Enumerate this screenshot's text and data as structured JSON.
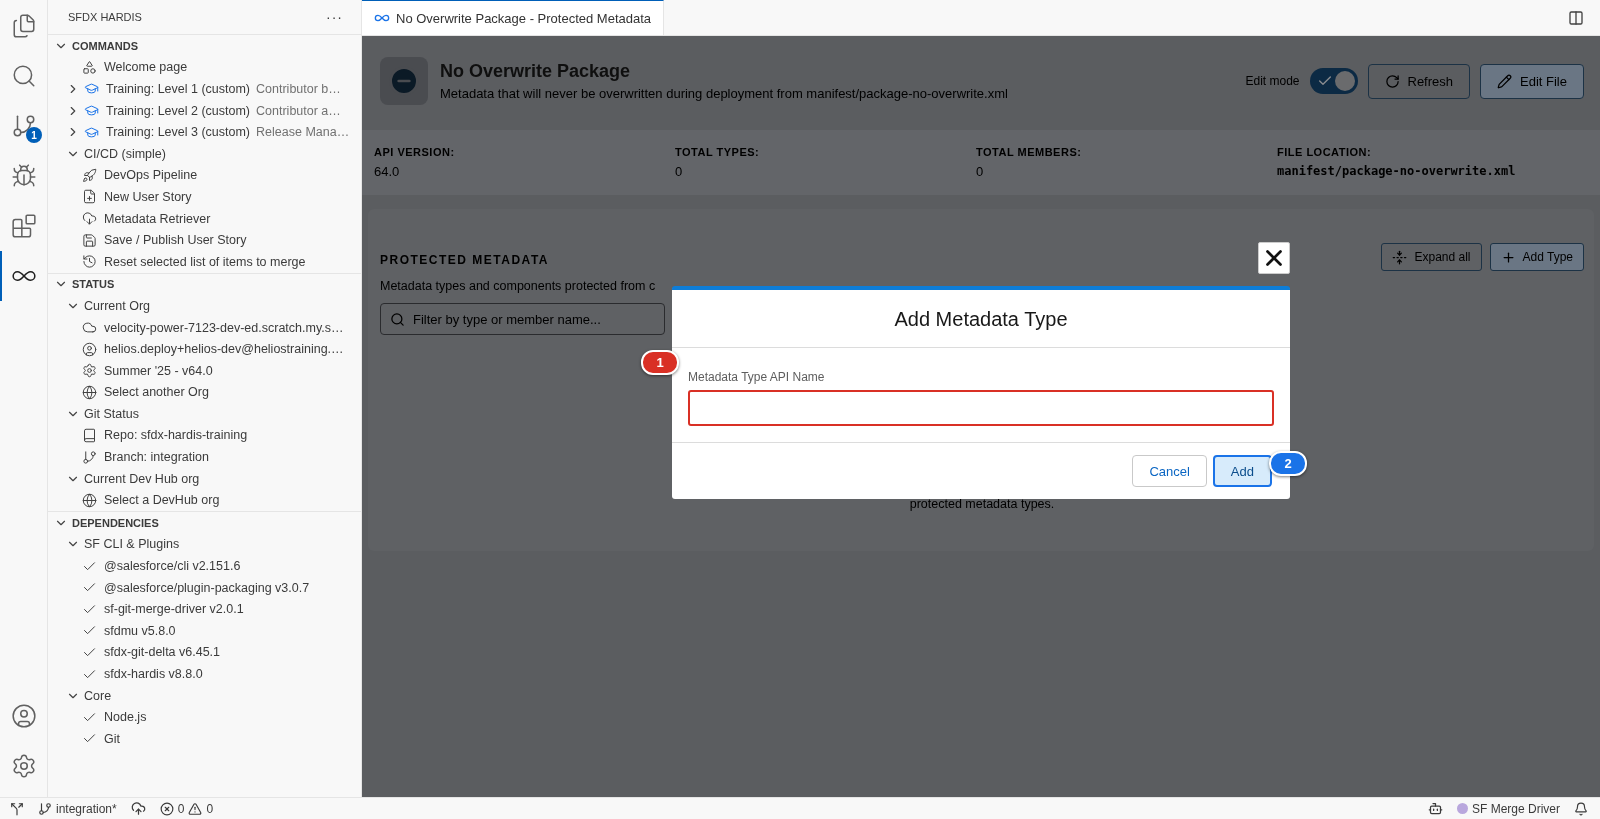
{
  "activity_bar": {
    "top": [
      {
        "kind": "files",
        "selected": false
      },
      {
        "kind": "search",
        "selected": false
      },
      {
        "kind": "source-control",
        "selected": false,
        "badge": "1"
      },
      {
        "kind": "run-debug",
        "selected": false
      },
      {
        "kind": "extensions",
        "selected": false
      },
      {
        "kind": "sfdx",
        "selected": true
      }
    ],
    "bottom": [
      {
        "kind": "account",
        "selected": false
      },
      {
        "kind": "settings",
        "selected": false
      }
    ]
  },
  "sidebar": {
    "title": "SFDX HARDIS",
    "menu": "···",
    "sections": [
      {
        "title": "COMMANDS",
        "expanded": true,
        "items": [
          {
            "label": "Welcome page",
            "kind": "welcome"
          },
          {
            "label": "Training: Level 1 (custom)",
            "description": "Contributor b…",
            "kind": "training",
            "expanded": false
          },
          {
            "label": "Training: Level 2 (custom)",
            "description": "Contributor a…",
            "kind": "training",
            "expanded": false
          },
          {
            "label": "Training: Level 3 (custom)",
            "description": "Release Mana…",
            "kind": "training",
            "expanded": false
          },
          {
            "label": "CI/CD (simple)",
            "expanded": true,
            "children": [
              {
                "label": "DevOps Pipeline",
                "kind": "rocket"
              },
              {
                "label": "New User Story",
                "kind": "file-add"
              },
              {
                "label": "Metadata Retriever",
                "kind": "cloud-download"
              },
              {
                "label": "Save / Publish User Story",
                "kind": "save"
              },
              {
                "label": "Reset selected list of items to merge",
                "kind": "history"
              }
            ]
          }
        ]
      },
      {
        "title": "STATUS",
        "expanded": true,
        "items": [
          {
            "label": "Current Org",
            "expanded": true,
            "children": [
              {
                "label": "velocity-power-7123-dev-ed.scratch.my.s…",
                "kind": "cloud"
              },
              {
                "label": "helios.deploy+helios-dev@heliostraining.…",
                "kind": "account"
              },
              {
                "label": "Summer '25 - v64.0",
                "kind": "gear"
              },
              {
                "label": "Select another Org",
                "kind": "globe"
              }
            ]
          },
          {
            "label": "Git Status",
            "expanded": true,
            "children": [
              {
                "label": "Repo: sfdx-hardis-training",
                "kind": "repo"
              },
              {
                "label": "Branch: integration",
                "kind": "branch"
              }
            ]
          },
          {
            "label": "Current Dev Hub org",
            "expanded": true,
            "children": [
              {
                "label": "Select a DevHub org",
                "kind": "globe"
              }
            ]
          }
        ]
      },
      {
        "title": "DEPENDENCIES",
        "expanded": true,
        "items": [
          {
            "label": "SF CLI & Plugins",
            "expanded": true,
            "children": [
              {
                "label": "@salesforce/cli v2.151.6",
                "kind": "check"
              },
              {
                "label": "@salesforce/plugin-packaging v3.0.7",
                "kind": "check"
              },
              {
                "label": "sf-git-merge-driver v2.0.1",
                "kind": "check"
              },
              {
                "label": "sfdmu v5.8.0",
                "kind": "check"
              },
              {
                "label": "sfdx-git-delta v6.45.1",
                "kind": "check"
              },
              {
                "label": "sfdx-hardis v8.8.0",
                "kind": "check"
              }
            ]
          },
          {
            "label": "Core",
            "expanded": true,
            "children": [
              {
                "label": "Node.js",
                "kind": "check"
              },
              {
                "label": "Git",
                "kind": "check"
              }
            ]
          }
        ]
      }
    ]
  },
  "tabs": [
    {
      "title": "No Overwrite Package - Protected Metadata",
      "selected": true
    }
  ],
  "page": {
    "title": "No Overwrite Package",
    "subtitle": "Metadata that will never be overwritten during deployment from manifest/package-no-overwrite.xml",
    "edit_mode": {
      "label": "Edit mode",
      "on": true
    },
    "buttons": [
      {
        "label": "Refresh",
        "kind": "refresh"
      },
      {
        "label": "Edit File",
        "kind": "edit"
      }
    ],
    "stats": [
      {
        "label": "API VERSION:",
        "value": "64.0",
        "kind": "text"
      },
      {
        "label": "TOTAL TYPES:",
        "value": "0",
        "kind": "text"
      },
      {
        "label": "TOTAL MEMBERS:",
        "value": "0",
        "kind": "text"
      },
      {
        "label": "FILE LOCATION:",
        "value": "manifest/package-no-overwrite.xml",
        "kind": "path"
      }
    ],
    "protected": {
      "heading": "PROTECTED METADATA",
      "description": "Metadata types and components protected from c",
      "filter": {
        "placeholder": "Filter by type or member name..."
      },
      "buttons": [
        {
          "label": "Expand all",
          "kind": "expand"
        },
        {
          "label": "Add Type",
          "kind": "add"
        }
      ],
      "empty_text": "protected metadata types."
    }
  },
  "modal": {
    "title": "Add Metadata Type",
    "field": {
      "label": "Metadata Type API Name"
    },
    "buttons": [
      {
        "label": "Cancel",
        "kind": "secondary"
      },
      {
        "label": "Add",
        "kind": "primary"
      }
    ]
  },
  "callouts": [
    {
      "label": "1",
      "color": "#d93025"
    },
    {
      "label": "2",
      "color": "#1a73e8"
    }
  ],
  "status_bar": {
    "branch": "integration*",
    "errors": "0",
    "warnings": "0",
    "right": "SF Merge Driver"
  }
}
